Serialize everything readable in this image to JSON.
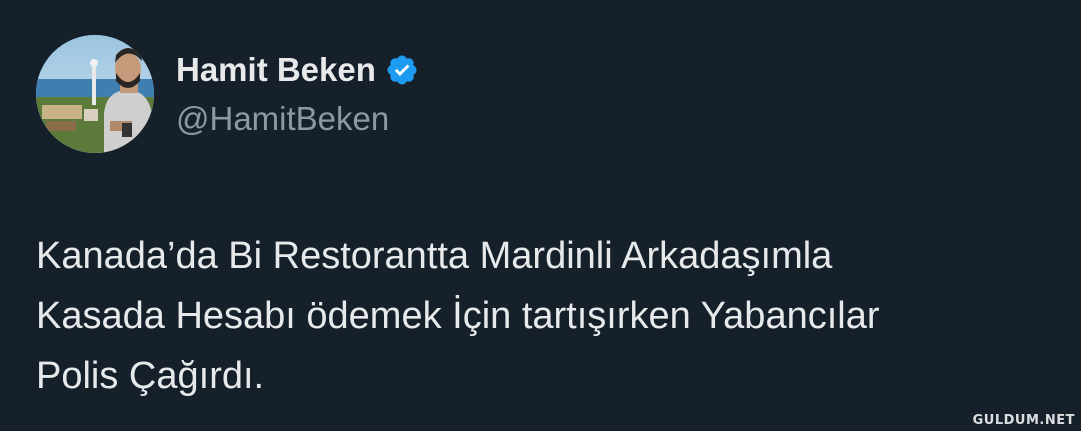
{
  "author": {
    "display_name": "Hamit Beken",
    "handle": "@HamitBeken",
    "verified": true
  },
  "tweet": {
    "lines": [
      "Kanada’da Bi Restorantta Mardinli Arkadaşımla",
      "Kasada Hesabı ödemek İçin tartışırken Yabancılar",
      "Polis Çağırdı."
    ]
  },
  "watermark": "GULDUM.NET",
  "colors": {
    "background": "#15202b",
    "primary_text": "#e7e9ea",
    "secondary_text": "#8b98a5",
    "verified_badge": "#1d9bf0"
  }
}
